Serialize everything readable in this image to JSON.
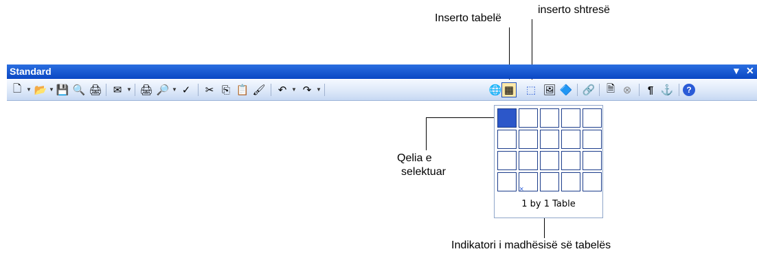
{
  "toolbar": {
    "title": "Standard",
    "dropdown_glyph": "▼",
    "close_glyph": "✕"
  },
  "buttons": [
    {
      "name": "new-document-icon",
      "glyph": "🗋"
    },
    {
      "name": "open-icon",
      "glyph": "📂"
    },
    {
      "name": "save-icon",
      "glyph": "💾"
    },
    {
      "name": "research-icon",
      "glyph": "🔍"
    },
    {
      "name": "permission-icon",
      "glyph": "🖨"
    },
    {
      "name": "email-icon",
      "glyph": "✉"
    },
    {
      "name": "print-icon",
      "glyph": "🖨"
    },
    {
      "name": "print-preview-icon",
      "glyph": "🔎"
    },
    {
      "name": "spelling-icon",
      "glyph": "✓"
    },
    {
      "name": "cut-icon",
      "glyph": "✂"
    },
    {
      "name": "copy-icon",
      "glyph": "⎘"
    },
    {
      "name": "paste-icon",
      "glyph": "📋"
    },
    {
      "name": "format-painter-icon",
      "glyph": "🖌"
    },
    {
      "name": "undo-icon",
      "glyph": "↶"
    },
    {
      "name": "redo-icon",
      "glyph": "↷"
    },
    {
      "name": "insert-hyperlink-icon",
      "glyph": "🌐"
    },
    {
      "name": "insert-table-icon",
      "glyph": "▦"
    },
    {
      "name": "insert-drawing-canvas-icon",
      "glyph": "⬚"
    },
    {
      "name": "insert-picture-icon",
      "glyph": "🖼"
    },
    {
      "name": "insert-chart-icon",
      "glyph": "🔷"
    },
    {
      "name": "hyperlink-icon",
      "glyph": "🔗"
    },
    {
      "name": "document-map-icon",
      "glyph": "🗎"
    },
    {
      "name": "stop-icon",
      "glyph": "⊗"
    },
    {
      "name": "show-hide-icon",
      "glyph": "¶"
    },
    {
      "name": "anchor-icon",
      "glyph": "⚓"
    },
    {
      "name": "help-icon",
      "glyph": "?"
    }
  ],
  "dropdown": {
    "size_label": "1 by 1 Table",
    "cursor_glyph": "×"
  },
  "annotations": {
    "insert_table": "Inserto tabelë",
    "insert_layer": "inserto shtresë",
    "selected_cell_line1": "Qelia e",
    "selected_cell_line2": "selektuar",
    "size_indicator": "Indikatori i madhësisë së tabelës"
  }
}
